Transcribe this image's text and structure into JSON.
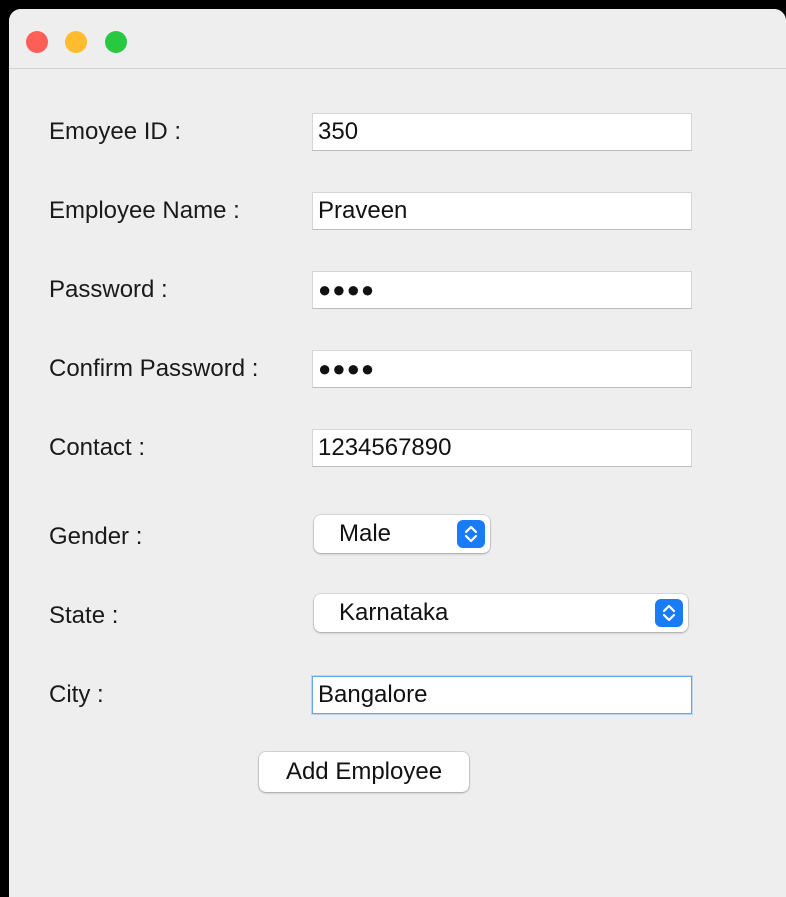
{
  "colors": {
    "close": "#ff5f57",
    "minimize": "#febc2e",
    "maximize": "#28c840",
    "accent": "#1a7cf5"
  },
  "form": {
    "employee_id": {
      "label": "Emoyee ID :",
      "value": "350"
    },
    "employee_name": {
      "label": "Employee Name :",
      "value": "Praveen"
    },
    "password": {
      "label": "Password :",
      "value": "●●●●"
    },
    "confirm_password": {
      "label": "Confirm Password :",
      "value": "●●●●"
    },
    "contact": {
      "label": "Contact :",
      "value": "1234567890"
    },
    "gender": {
      "label": "Gender :",
      "selected": "Male"
    },
    "state": {
      "label": "State :",
      "selected": "Karnataka"
    },
    "city": {
      "label": "City :",
      "value": "Bangalore"
    }
  },
  "actions": {
    "add_employee_label": "Add Employee"
  },
  "icons": {
    "select_stepper": "chevron-up-down-icon"
  }
}
